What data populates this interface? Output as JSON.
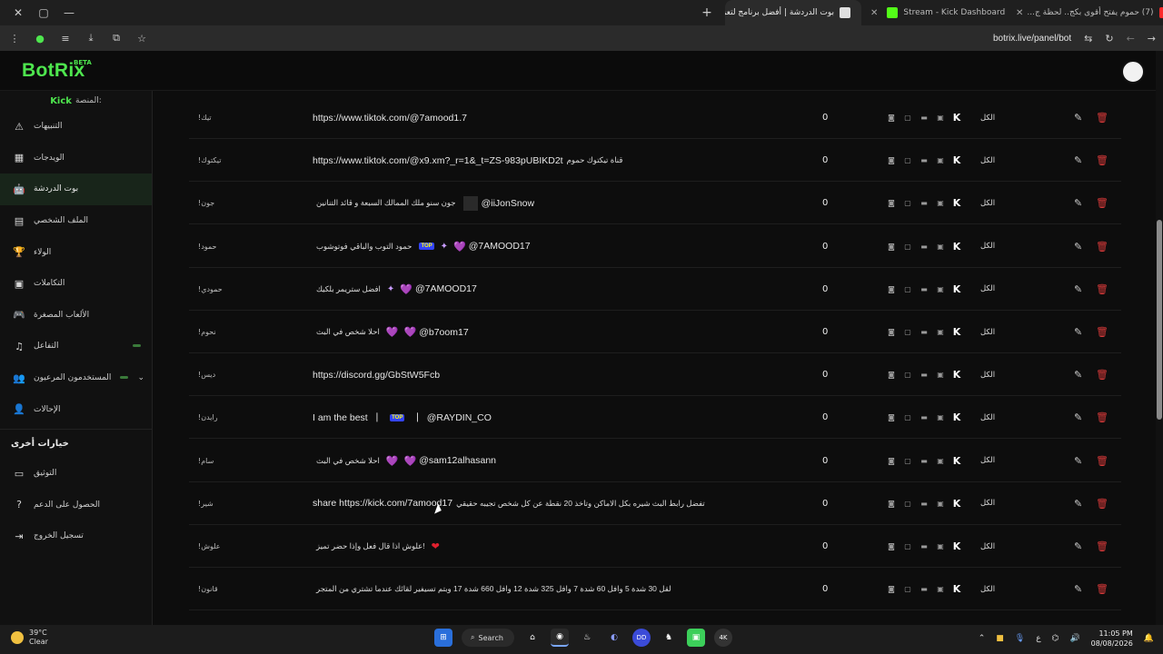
{
  "browser": {
    "window_controls": [
      "✕",
      "▢",
      "—"
    ],
    "tabs": [
      {
        "label": "بوت الدردشة | أفضل برنامج لتعز...",
        "active": true,
        "fav_color": "#e0e0e0"
      },
      {
        "label": "Stream - Kick Dashboard",
        "active": false,
        "fav_color": "#53fc18"
      },
      {
        "label": "(7) حموم يفتح أقوى بكج.. لحظة ج...",
        "active": false,
        "fav_color": "#ff2a2a"
      }
    ],
    "new_tab_label": "+",
    "url": "botrix.live/panel/bot"
  },
  "app": {
    "logo": "BotRix",
    "beta": "BETA"
  },
  "sidebar": {
    "platform_label": "المنصة:",
    "platform_value": "Kick",
    "items": [
      {
        "label": "التنبيهات",
        "icon": "warning-icon",
        "glyph": "⚠"
      },
      {
        "label": "الويدجات",
        "icon": "widgets-icon",
        "glyph": "▦"
      },
      {
        "label": "بوت الدردشة",
        "icon": "robot-icon",
        "glyph": "🤖",
        "active": true
      },
      {
        "label": "الملف الشخصي",
        "icon": "profile-card-icon",
        "glyph": "▤"
      },
      {
        "label": "الولاء",
        "icon": "trophy-icon",
        "glyph": "🏆"
      },
      {
        "label": "التكاملات",
        "icon": "integrations-icon",
        "glyph": "▣"
      },
      {
        "label": "الألعاب المصغرة",
        "icon": "gamepad-icon",
        "glyph": "🎮"
      },
      {
        "label": "التفاعل",
        "icon": "music-icon",
        "glyph": "♫",
        "badge": true
      },
      {
        "label": "المستخدمون المرعيون",
        "icon": "users-icon",
        "glyph": "👥",
        "badge": true,
        "chevron": "⌄"
      },
      {
        "label": "الإحالات",
        "icon": "referrals-icon",
        "glyph": "👤"
      }
    ],
    "section_other": "خيارات أخرى",
    "other_items": [
      {
        "label": "التوثيق",
        "icon": "docs-icon",
        "glyph": "▭"
      },
      {
        "label": "الحصول على الدعم",
        "icon": "help-icon",
        "glyph": "?"
      },
      {
        "label": "تسجيل الخروج",
        "icon": "logout-icon",
        "glyph": "⇥"
      }
    ]
  },
  "commands": [
    {
      "cmd": "!تيك",
      "response_parts": [
        "https://www.tiktok.com/@7amood1.7"
      ],
      "cooldown": "0",
      "scope": "الكل"
    },
    {
      "cmd": "!تيكتوك",
      "response_parts": [
        "https://www.tiktok.com/@x9.xm?_r=1&_t=ZS-983pUBIKD2t",
        "قناة تيكتوك حموم"
      ],
      "cooldown": "0",
      "scope": "الكل"
    },
    {
      "cmd": "!جون",
      "response_parts": [
        "@iiJonSnow",
        "جون سنو ملك الممالك السبعة و قائد التنانين"
      ],
      "cooldown": "0",
      "scope": "الكل"
    },
    {
      "cmd": "!حمود",
      "response_parts": [
        "@7AMOOD17",
        "حمود التوب والباقي فوتوشوب"
      ],
      "cooldown": "0",
      "scope": "الكل"
    },
    {
      "cmd": "!حمودي",
      "response_parts": [
        "@7AMOOD17",
        "افضل ستريمر بلكيك"
      ],
      "cooldown": "0",
      "scope": "الكل"
    },
    {
      "cmd": "!نحوم",
      "response_parts": [
        "@b7oom17",
        "احلا شخص في البث"
      ],
      "cooldown": "0",
      "scope": "الكل"
    },
    {
      "cmd": "!ديس",
      "response_parts": [
        "https://discord.gg/GbStW5Fcb"
      ],
      "cooldown": "0",
      "scope": "الكل"
    },
    {
      "cmd": "!رايدن",
      "response_parts": [
        "I am the best",
        "@RAYDIN_CO"
      ],
      "cooldown": "0",
      "scope": "الكل"
    },
    {
      "cmd": "!سام",
      "response_parts": [
        "@sam12alhasann",
        "احلا شخص في البث"
      ],
      "cooldown": "0",
      "scope": "الكل"
    },
    {
      "cmd": "!شير",
      "response_parts": [
        "share https://kick.com/7amood17",
        "تفضل رابط البث شيره بكل الاماكن وتاخذ 20 نقطة عن كل شخص تجيبه حقيقي"
      ],
      "cooldown": "0",
      "scope": "الكل"
    },
    {
      "cmd": "!علوش",
      "response_parts": [
        "علوش اذا قال فعل وإذا حضر تميز!"
      ],
      "cooldown": "0",
      "scope": "الكل"
    },
    {
      "cmd": "!قانون",
      "response_parts": [
        "لقل 30 شدة 5 وافل 60 شدة 7 وافل 325 شدة 12 وافل 660 شدة 17 وبتم تسيفير لقائك عندما تشتري من المتجر"
      ],
      "cooldown": "0",
      "scope": "الكل"
    }
  ],
  "taskbar": {
    "temp": "39°C",
    "weather": "Clear",
    "search_label": "Search",
    "time": "11:05 PM",
    "date": "08/08/2026",
    "lang": "ع"
  }
}
